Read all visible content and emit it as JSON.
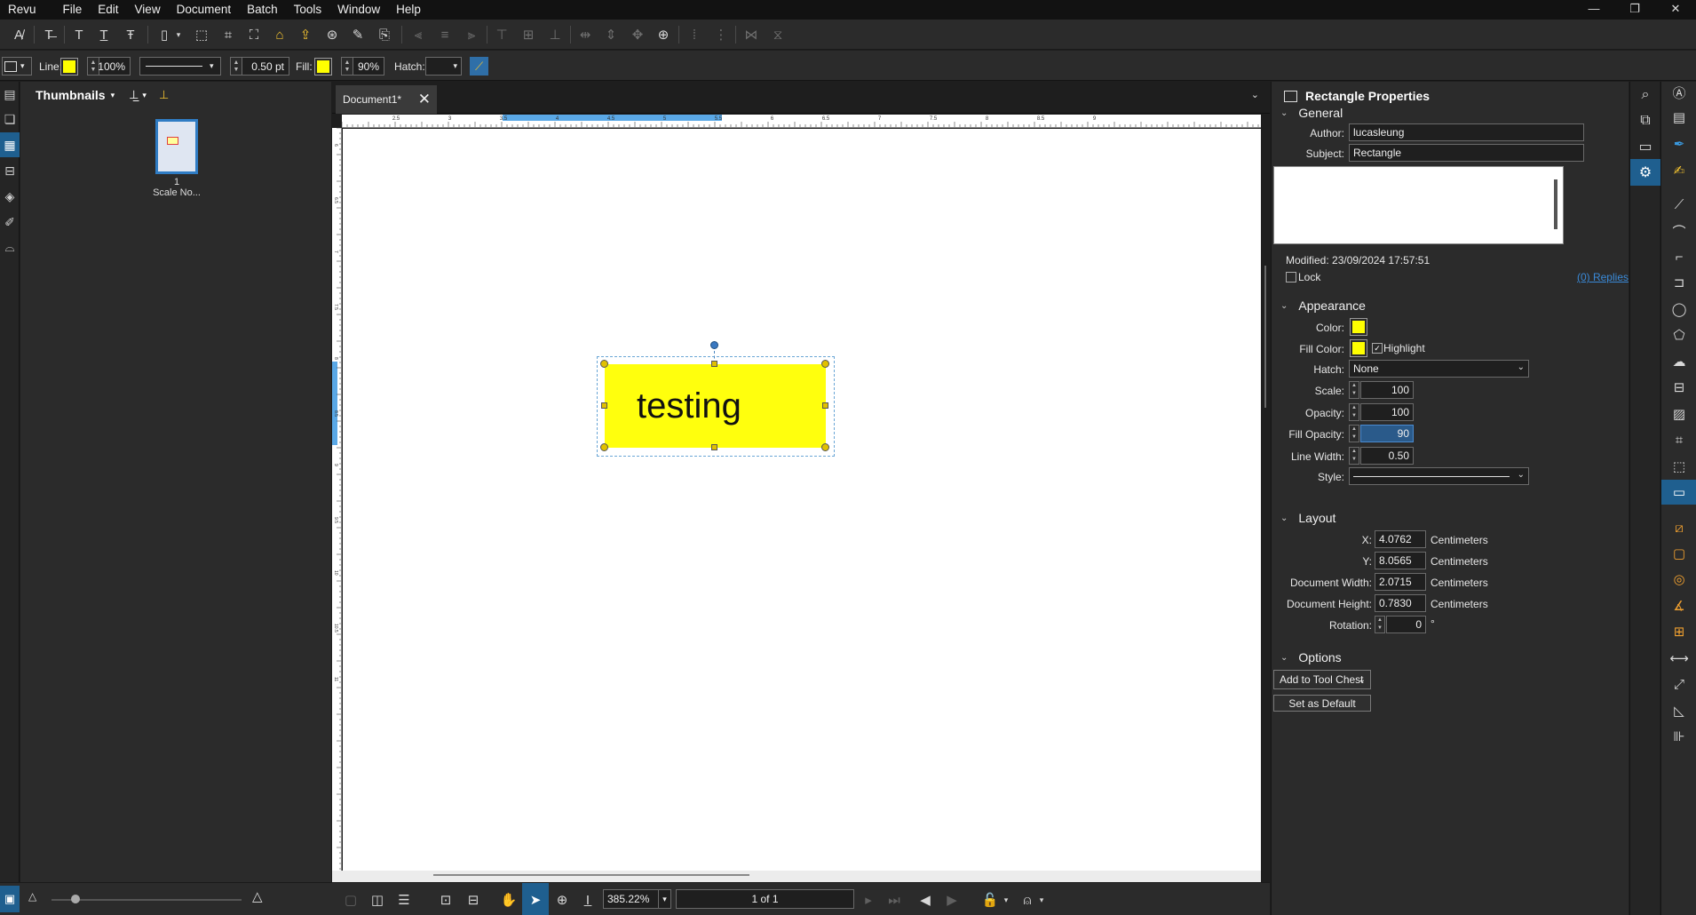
{
  "menu": {
    "items": [
      "Revu",
      "File",
      "Edit",
      "View",
      "Document",
      "Batch",
      "Tools",
      "Window",
      "Help"
    ],
    "window_buttons": [
      "—",
      "❐",
      "✕"
    ]
  },
  "toolbar1": {
    "icons": [
      "spellcheck-icon",
      "text-format-icon",
      "text-icon",
      "underline-text-icon",
      "strikethrough-text-icon",
      "page-icon",
      "crop-select-icon",
      "crop-icon",
      "select-icon",
      "bell-icon",
      "flatten-icon",
      "overlay-icon",
      "eraser-icon",
      "paste-icon",
      "align-left-icon",
      "align-center-icon",
      "align-right-icon",
      "align-top-icon",
      "align-middle-icon",
      "align-bottom-icon",
      "distribute-icon",
      "distribute-vertical-icon",
      "move-icon",
      "target-icon",
      "group-icon",
      "ungroup-icon",
      "flip-icon",
      "mirror-icon"
    ]
  },
  "toolbar2": {
    "line_label": "Line:",
    "line_color": "#ffff00",
    "line_opacity": "100%",
    "line_width": "0.50 pt",
    "fill_label": "Fill:",
    "fill_color": "#ffff00",
    "fill_opacity": "90%",
    "hatch_label": "Hatch:"
  },
  "thumbnails": {
    "title": "Thumbnails",
    "page_number": "1",
    "page_label": "Scale No..."
  },
  "document": {
    "tab_title": "Document1*",
    "annotation_text": "testing",
    "ruler_top_labels": [
      "2.5",
      "3",
      "3.5",
      "4",
      "4.5",
      "5",
      "5.5",
      "6",
      "6.5",
      "7",
      "7.5",
      "8",
      "8.5",
      "9"
    ],
    "ruler_left_labels": [
      "6",
      "6.5",
      "7",
      "7.5",
      "8",
      "8.5",
      "9",
      "9.5",
      "10",
      "10.5",
      "11"
    ]
  },
  "statusbar": {
    "zoom": "385.22%",
    "page_indicator": "1 of 1"
  },
  "properties": {
    "title": "Rectangle Properties",
    "general": {
      "heading": "General",
      "author_label": "Author:",
      "author": "lucasleung",
      "subject_label": "Subject:",
      "subject": "Rectangle",
      "modified": "Modified: 23/09/2024 17:57:51",
      "lock_label": "Lock",
      "replies": "(0) Replies"
    },
    "appearance": {
      "heading": "Appearance",
      "color_label": "Color:",
      "color": "#ffff00",
      "fill_color_label": "Fill Color:",
      "fill_color": "#ffff00",
      "highlight_label": "Highlight",
      "hatch_label": "Hatch:",
      "hatch": "None",
      "scale_label": "Scale:",
      "scale": "100",
      "opacity_label": "Opacity:",
      "opacity": "100",
      "fill_opacity_label": "Fill Opacity:",
      "fill_opacity": "90",
      "line_width_label": "Line Width:",
      "line_width": "0.50",
      "style_label": "Style:"
    },
    "layout": {
      "heading": "Layout",
      "x_label": "X:",
      "x": "4.0762",
      "y_label": "Y:",
      "y": "8.0565",
      "width_label": "Document Width:",
      "width": "2.0715",
      "height_label": "Document Height:",
      "height": "0.7830",
      "rotation_label": "Rotation:",
      "rotation": "0",
      "rotation_unit": "°",
      "unit": "Centimeters"
    },
    "options": {
      "heading": "Options",
      "add_to_tool_chest": "Add to Tool Chest",
      "set_as_default": "Set as Default"
    }
  }
}
